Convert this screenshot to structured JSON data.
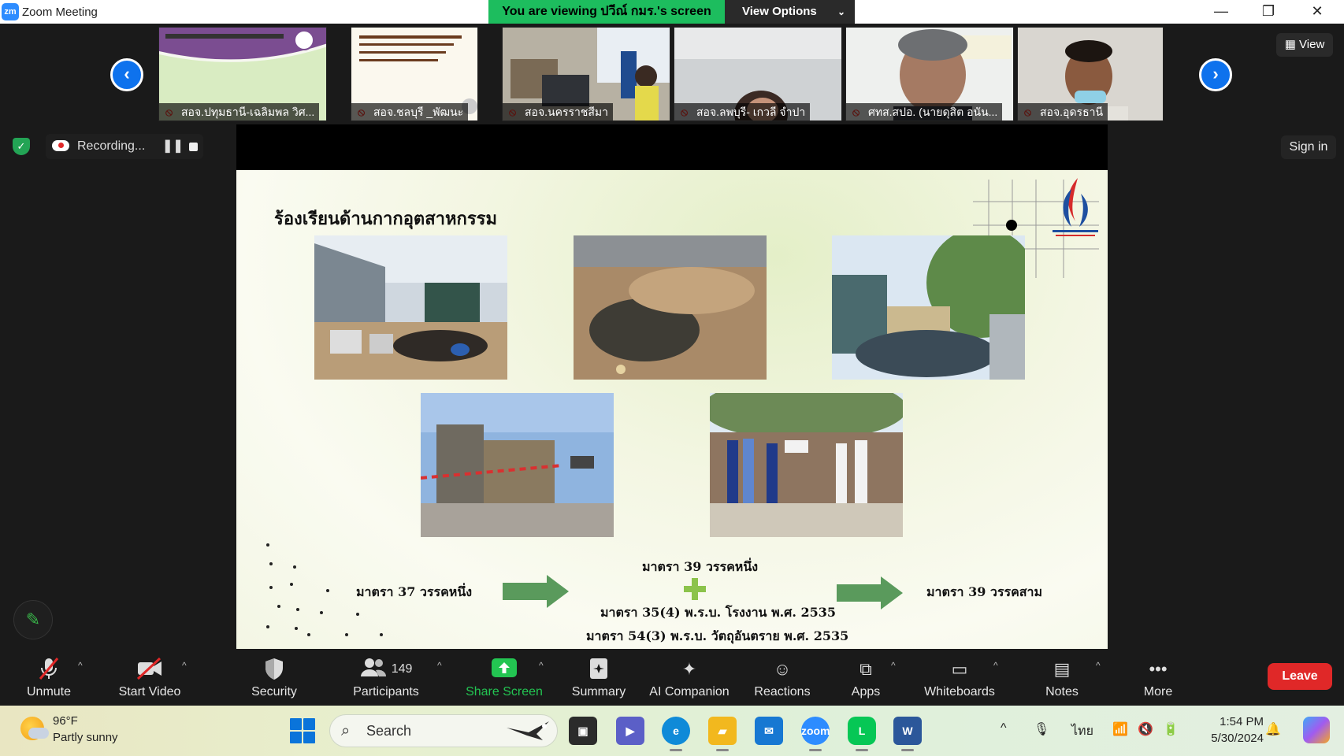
{
  "window": {
    "app_icon": "zm",
    "title": "Zoom Meeting",
    "minimize": "—",
    "restore": "❐",
    "close": "✕"
  },
  "banner": {
    "text": "You are viewing ปวีณ์ กมร.'s screen",
    "view_options": "View Options"
  },
  "filmstrip": {
    "participants": [
      {
        "name": "สอจ.ปทุมธานี-เฉลิมพล วิศ..."
      },
      {
        "name": "สอจ.ชลบุรี _พัฒนะ"
      },
      {
        "name": "สอจ.นครราชสีมา"
      },
      {
        "name": "สอจ.ลพบุรี- เกวลี จำปา"
      },
      {
        "name": "ศทส.สปอ. (นายดุสิต อนัน..."
      },
      {
        "name": "สอจ.อุดรธานี"
      }
    ],
    "view_label": "View"
  },
  "recording": {
    "label": "Recording..."
  },
  "sign_in": "Sign in",
  "slide": {
    "title": "ร้องเรียนด้านกากอุตสาหกรรม",
    "left_label": "มาตรา 37 วรรคหนึ่ง",
    "mid_top": "มาตรา 39 วรรคหนึ่ง",
    "mid_line1": "มาตรา 35(4) พ.ร.บ. โรงงาน พ.ศ. 2535",
    "mid_line2": "มาตรา 54(3) พ.ร.บ. วัตถุอันตราย พ.ศ. 2535",
    "right_label": "มาตรา 39 วรรคสาม",
    "accent_green": "#5a9a5c"
  },
  "toolbar": {
    "unmute": "Unmute",
    "start_video": "Start Video",
    "security": "Security",
    "participants": "Participants",
    "participants_count": "149",
    "share_screen": "Share Screen",
    "summary": "Summary",
    "ai_companion": "AI Companion",
    "reactions": "Reactions",
    "apps": "Apps",
    "whiteboards": "Whiteboards",
    "notes": "Notes",
    "more": "More",
    "leave": "Leave",
    "share_color": "#23c552",
    "leave_color": "#e02828"
  },
  "taskbar": {
    "temp": "96°F",
    "weather": "Partly sunny",
    "search_placeholder": "Search",
    "lang": "ไทย",
    "time": "1:54 PM",
    "date": "5/30/2024"
  }
}
